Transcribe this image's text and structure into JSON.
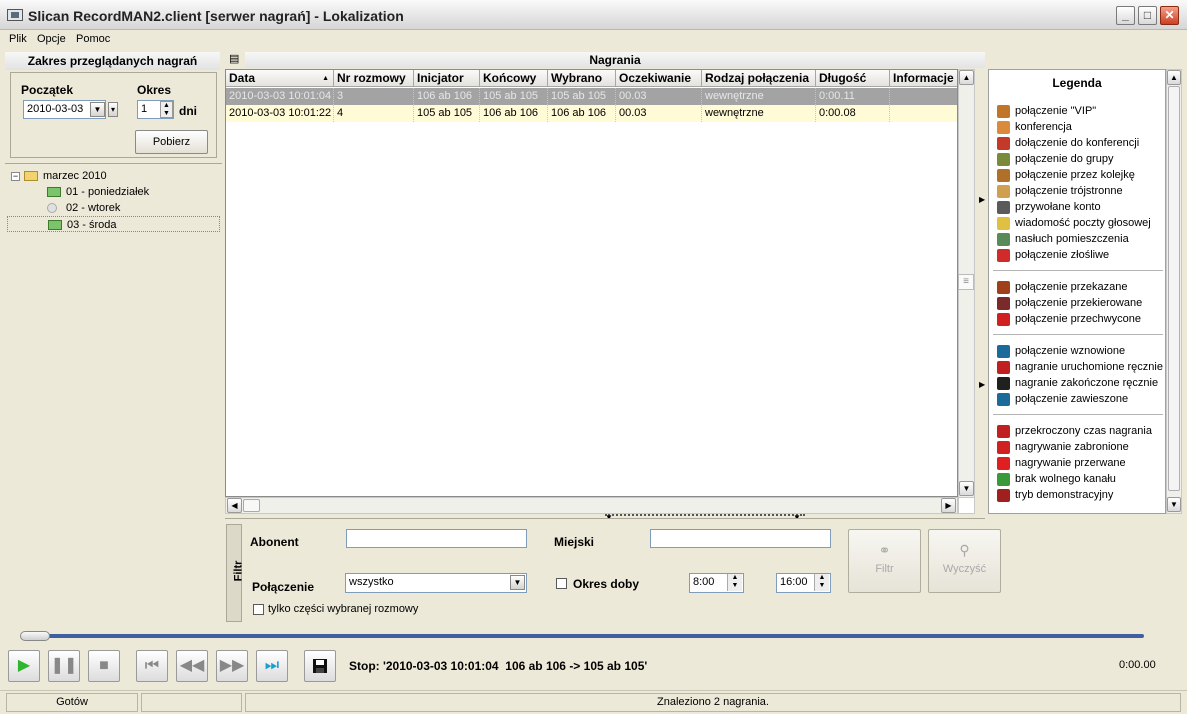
{
  "window": {
    "title": "Slican RecordMAN2.client [serwer nagrań] - Lokalization"
  },
  "menu": [
    "Plik",
    "Opcje",
    "Pomoc"
  ],
  "left_panel": {
    "header": "Zakres przeglądanych nagrań",
    "start_label": "Początek",
    "start_value": "2010-03-03",
    "period_label": "Okres",
    "period_value": "1",
    "period_unit": "dni",
    "fetch_button": "Pobierz",
    "tree": {
      "root": "marzec 2010",
      "days": [
        "01 - poniedziałek",
        "02 - wtorek",
        "03 - środa"
      ]
    }
  },
  "grid": {
    "title": "Nagrania",
    "columns": [
      "Data",
      "Nr rozmowy",
      "Inicjator",
      "Końcowy",
      "Wybrano",
      "Oczekiwanie",
      "Rodzaj połączenia",
      "Długość",
      "Informacje"
    ],
    "rows": [
      [
        "2010-03-03 10:01:04",
        "3",
        "106 ab 106",
        "105 ab 105",
        "105 ab 105",
        "00.03",
        "wewnętrzne",
        "0:00.11",
        ""
      ],
      [
        "2010-03-03 10:01:22",
        "4",
        "105 ab 105",
        "106 ab 106",
        "106 ab 106",
        "00.03",
        "wewnętrzne",
        "0:00.08",
        ""
      ]
    ]
  },
  "legend": {
    "title": "Legenda",
    "groups": [
      [
        "połączenie \"VIP\"",
        "konferencja",
        "dołączenie do konferencji",
        "połączenie do grupy",
        "połączenie przez kolejkę",
        "połączenie trójstronne",
        "przywołane konto",
        "wiadomość poczty głosowej",
        "nasłuch pomieszczenia",
        "połączenie złośliwe"
      ],
      [
        "połączenie przekazane",
        "połączenie przekierowane",
        "połączenie przechwycone"
      ],
      [
        "połączenie wznowione",
        "nagranie uruchomione ręcznie",
        "nagranie zakończone ręcznie",
        "połączenie zawieszone"
      ],
      [
        "przekroczony czas nagrania",
        "nagrywanie zabronione",
        "nagrywanie przerwane",
        "brak wolnego kanału",
        "tryb demonstracyjny"
      ]
    ],
    "icon_colors": [
      [
        "#c0752a",
        "#d98a3a",
        "#c43a2a",
        "#7a8a3a",
        "#b0702a",
        "#d0a050",
        "#5a5a5a",
        "#e0c040",
        "#5a8a5a",
        "#d02a2a"
      ],
      [
        "#a0401a",
        "#7a2a2a",
        "#d02020"
      ],
      [
        "#1a6a9a",
        "#c02020",
        "#202020",
        "#1a6a9a"
      ],
      [
        "#c02020",
        "#d02020",
        "#e02020",
        "#3a9a3a",
        "#a02020"
      ]
    ]
  },
  "filter": {
    "tab_label": "Filtr",
    "subscriber_label": "Abonent",
    "subscriber_value": "",
    "city_label": "Miejski",
    "city_value": "",
    "connection_label": "Połączenie",
    "connection_value": "wszystko",
    "day_period_label": "Okres doby",
    "time_from": "8:00",
    "time_to": "16:00",
    "only_selected_label": "tylko części wybranej rozmowy",
    "filter_button": "Filtr",
    "clear_button": "Wyczyść"
  },
  "player": {
    "stop_text": "Stop: '2010-03-03 10:01:04  106 ab 106 -> 105 ab 105'",
    "time": "0:00.00"
  },
  "status": {
    "left": "Gotów",
    "right": "Znaleziono 2 nagrania."
  }
}
